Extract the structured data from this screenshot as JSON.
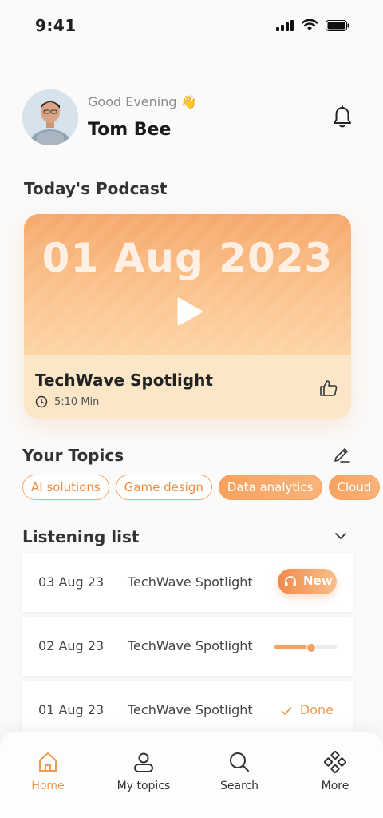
{
  "status_bar": {
    "time": "9:41"
  },
  "header": {
    "greeting": "Good Evening 👋",
    "user_name": "Tom Bee"
  },
  "sections": {
    "today": "Today's Podcast",
    "topics": "Your Topics",
    "listening": "Listening list"
  },
  "podcast": {
    "date": "01 Aug 2023",
    "title": "TechWave Spotlight",
    "duration": "5:10 Min"
  },
  "topics": [
    {
      "label": "AI solutions",
      "active": false
    },
    {
      "label": "Game design",
      "active": false
    },
    {
      "label": "Data analytics",
      "active": true
    },
    {
      "label": "Cloud",
      "active": true
    }
  ],
  "listening_list": [
    {
      "date": "03 Aug 23",
      "title": "TechWave Spotlight",
      "status": "new",
      "status_label": "New"
    },
    {
      "date": "02 Aug 23",
      "title": "TechWave Spotlight",
      "status": "progress",
      "progress": 0.58
    },
    {
      "date": "01 Aug 23",
      "title": "TechWave Spotlight",
      "status": "done",
      "status_label": "Done"
    }
  ],
  "nav": [
    {
      "label": "Home",
      "icon": "home-icon",
      "active": true
    },
    {
      "label": "My topics",
      "icon": "user-icon",
      "active": false
    },
    {
      "label": "Search",
      "icon": "search-icon",
      "active": false
    },
    {
      "label": "More",
      "icon": "more-icon",
      "active": false
    }
  ],
  "colors": {
    "accent": "#F39A52",
    "accent_light": "#FBE6C8",
    "background": "#FAFAFA"
  }
}
